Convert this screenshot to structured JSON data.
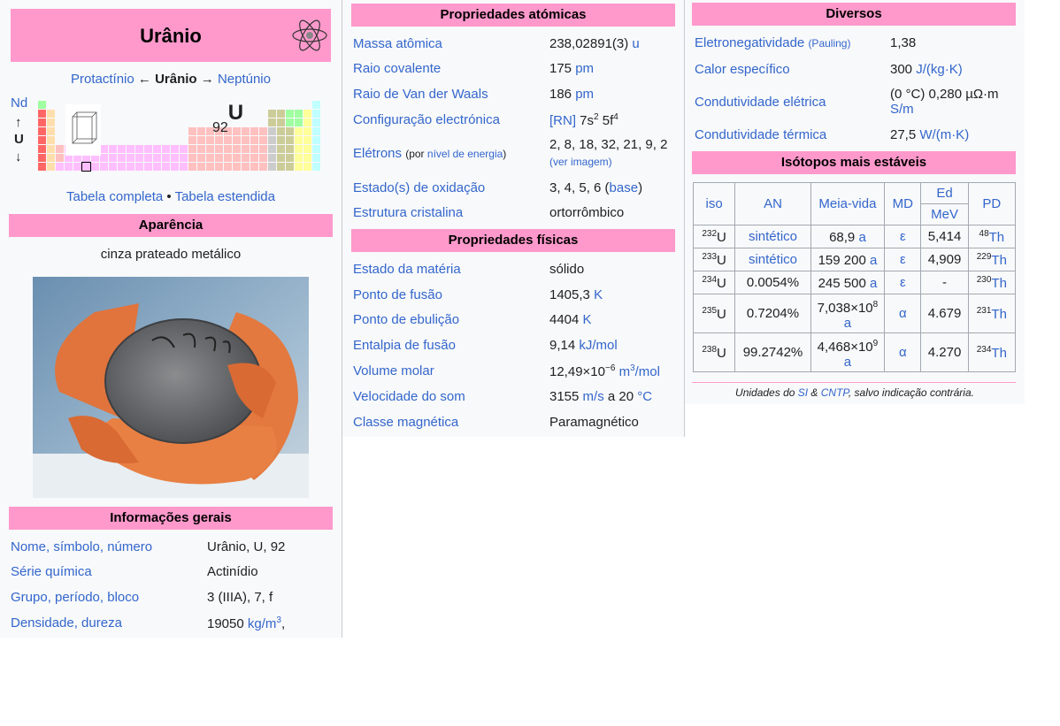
{
  "title": "Urânio",
  "nav": {
    "prev": "Protactínio",
    "arrow_left": "←",
    "current": "Urânio",
    "arrow_right": "→",
    "next": "Neptúnio"
  },
  "mini_table": {
    "above": "Nd",
    "up_arrow": "↑",
    "symbol_center": "U",
    "down_arrow": "↓",
    "atomic_number": "92",
    "symbol": "U"
  },
  "table_links": {
    "complete": "Tabela completa",
    "sep": "•",
    "extended": "Tabela estendida"
  },
  "appearance": {
    "header": "Aparência",
    "description": "cinza prateado metálico"
  },
  "general": {
    "header": "Informações gerais",
    "rows": [
      {
        "label": "Nome, símbolo, número",
        "value": "Urânio, U, 92"
      },
      {
        "label": "Série química",
        "value": "Actinídio"
      },
      {
        "label": "Grupo, período, bloco",
        "value": "3 (IIIA), 7, f"
      },
      {
        "label": "Densidade, dureza",
        "value": "19050",
        "unit": "kg/m",
        "unit_sup": "3",
        "tail": ","
      }
    ]
  },
  "atomic": {
    "header": "Propriedades atómicas",
    "mass_label": "Massa atômica",
    "mass_value": "238,02891(3)",
    "mass_unit": "u",
    "covalent_label": "Raio covalente",
    "covalent_value": "175",
    "covalent_unit": "pm",
    "vdw_label": "Raio de Van der Waals",
    "vdw_value": "186",
    "vdw_unit": "pm",
    "config_label": "Configuração electrónica",
    "config_rn": "[RN]",
    "config_a": "7s",
    "config_a_sup": "2",
    "config_b": "5f",
    "config_b_sup": "4",
    "electrons_label": "Elétrons",
    "electrons_paren_open": "(por ",
    "electrons_level": "nível de energia",
    "electrons_paren_close": ")",
    "electrons_value": "2, 8, 18, 32, 21, 9, 2",
    "electrons_image": "(ver imagem)",
    "oxidation_label": "Estado(s) de oxidação",
    "oxidation_value": "3, 4, 5, 6 (",
    "oxidation_base": "base",
    "oxidation_close": ")",
    "crystal_label": "Estrutura cristalina",
    "crystal_value": "ortorrômbico"
  },
  "physical": {
    "header": "Propriedades físicas",
    "matter_label": "Estado da matéria",
    "matter_value": "sólido",
    "melt_label": "Ponto de fusão",
    "melt_value": "1405,3",
    "melt_unit": "K",
    "boil_label": "Ponto de ebulição",
    "boil_value": "4404",
    "boil_unit": "K",
    "enthalpy_label": "Entalpia de fusão",
    "enthalpy_value": "9,14",
    "enthalpy_unit": "kJ/mol",
    "molar_label": "Volume molar",
    "molar_value": "12,49×10",
    "molar_exp": "−6",
    "molar_unit": "m",
    "molar_unit_sup": "3",
    "molar_unit_tail": "/mol",
    "sound_label": "Velocidade do som",
    "sound_value": "3155",
    "sound_unit": "m/s",
    "sound_mid": "a 20",
    "sound_temp": "°C",
    "magnetic_label": "Classe magnética",
    "magnetic_value": "Paramagnético"
  },
  "misc": {
    "header": "Diversos",
    "electroneg_label": "Eletronegatividade",
    "electroneg_scale": "(Pauling)",
    "electroneg_value": "1,38",
    "heat_label": "Calor específico",
    "heat_value": "300",
    "heat_unit": "J/(kg·K)",
    "elec_cond_label": "Condutividade elétrica",
    "elec_cond_value": "(0 °C) 0,280 µΩ·m",
    "elec_cond_unit": "S/m",
    "therm_cond_label": "Condutividade térmica",
    "therm_cond_value": "27,5",
    "therm_cond_unit": "W/(m·K)"
  },
  "isotopes": {
    "header": "Isótopos mais estáveis",
    "columns": {
      "iso": "iso",
      "an": "AN",
      "halflife": "Meia-vida",
      "md": "MD",
      "ed": "Ed",
      "ed_unit": "MeV",
      "pd": "PD"
    },
    "rows": [
      {
        "iso_sup": "232",
        "iso": "U",
        "an": "sintético",
        "hl": "68,9",
        "hl_sup": "",
        "hl_unit": "a",
        "md": "ε",
        "ed": "5,414",
        "pd_sup": "48",
        "pd": "Th"
      },
      {
        "iso_sup": "233",
        "iso": "U",
        "an": "sintético",
        "hl": "159 200",
        "hl_sup": "",
        "hl_unit": "a",
        "md": "ε",
        "ed": "4,909",
        "pd_sup": "229",
        "pd": "Th"
      },
      {
        "iso_sup": "234",
        "iso": "U",
        "an": "0.0054%",
        "hl": "245 500",
        "hl_sup": "",
        "hl_unit": "a",
        "md": "ε",
        "ed": "-",
        "pd_sup": "230",
        "pd": "Th"
      },
      {
        "iso_sup": "235",
        "iso": "U",
        "an": "0.7204%",
        "hl": "7,038×10",
        "hl_sup": "8",
        "hl_unit": "a",
        "md": "α",
        "ed": "4.679",
        "pd_sup": "231",
        "pd": "Th"
      },
      {
        "iso_sup": "238",
        "iso": "U",
        "an": "99.2742%",
        "hl": "4,468×10",
        "hl_sup": "9",
        "hl_unit": "a",
        "md": "α",
        "ed": "4.270",
        "pd_sup": "234",
        "pd": "Th"
      }
    ],
    "footer_pre": "Unidades do ",
    "footer_si": "SI",
    "footer_amp": " & ",
    "footer_cntp": "CNTP",
    "footer_post": ", salvo indicação contrária."
  },
  "colors": {
    "header_pink": "#ff99cc",
    "link": "#3366cc",
    "panel_bg": "#f8f9fa"
  },
  "icons": {
    "atom": "atom-icon",
    "photo": "uranium-disc-photo",
    "crystal": "orthorhombic-cell-diagram"
  }
}
